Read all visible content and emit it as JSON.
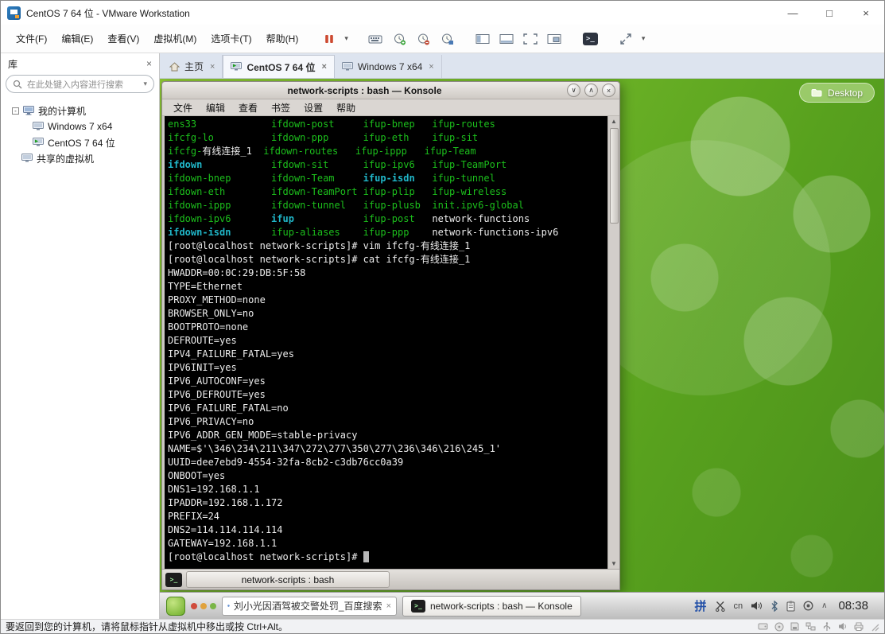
{
  "icons": {
    "minimize": "—",
    "maximize": "□",
    "close": "×",
    "caret_down": "▾",
    "item_close": "×",
    "scroll_up": "▲",
    "scroll_down": "▼",
    "k_min": "∨",
    "k_max": "∧",
    "k_close": "×",
    "tray_caret": "∧",
    "console_prompt": ">_"
  },
  "colors": {
    "terminal_bg": "#000000",
    "terminal_green": "#1CBF1C",
    "terminal_cyan": "#20B6C8",
    "terminal_fg": "#EDEDED",
    "cursor": "#B8B8B8",
    "wallpaper_green": "#6DB327"
  },
  "vmware": {
    "window_title": "CentOS 7 64 位 - VMware Workstation",
    "menus": [
      "文件(F)",
      "编辑(E)",
      "查看(V)",
      "虚拟机(M)",
      "选项卡(T)",
      "帮助(H)"
    ],
    "tabs": [
      {
        "label": "主页"
      },
      {
        "label": "CentOS 7 64 位"
      },
      {
        "label": "Windows 7 x64"
      }
    ],
    "status_message": "要返回到您的计算机，请将鼠标指针从虚拟机中移出或按 Ctrl+Alt。"
  },
  "library": {
    "title": "库",
    "search_placeholder": "在此处键入内容进行搜索",
    "tree": [
      {
        "label": "我的计算机"
      },
      {
        "label": "Windows 7 x64"
      },
      {
        "label": "CentOS 7 64 位"
      },
      {
        "label": "共享的虚拟机"
      }
    ]
  },
  "vm_desktop": {
    "widget_label": "Desktop",
    "taskbar": {
      "search_text": "刘小光因酒驾被交警处罚_百度搜索",
      "konsole_task": "network-scripts : bash — Konsole",
      "input_method": "拼",
      "keyboard_layout": "cn",
      "clock": "08:38"
    }
  },
  "konsole": {
    "title": "network-scripts : bash — Konsole",
    "menus": [
      "文件",
      "编辑",
      "查看",
      "书签",
      "设置",
      "帮助"
    ],
    "tab_label": "network-scripts : bash"
  },
  "terminal": {
    "lines": [
      [
        {
          "t": "ens33             ",
          "c": "g"
        },
        {
          "t": "ifdown-post     ",
          "c": "g"
        },
        {
          "t": "ifup-bnep   ",
          "c": "g"
        },
        {
          "t": "ifup-routes",
          "c": "g"
        }
      ],
      [
        {
          "t": "ifcfg-lo          ",
          "c": "g"
        },
        {
          "t": "ifdown-ppp      ",
          "c": "g"
        },
        {
          "t": "ifup-eth    ",
          "c": "g"
        },
        {
          "t": "ifup-sit",
          "c": "g"
        }
      ],
      [
        {
          "t": "ifcfg-",
          "c": "g"
        },
        {
          "t": "有线连接_1",
          "c": "w"
        },
        {
          "t": "  ",
          "c": "g"
        },
        {
          "t": "ifdown-routes   ",
          "c": "g"
        },
        {
          "t": "ifup-ippp   ",
          "c": "g"
        },
        {
          "t": "ifup-Team",
          "c": "g"
        }
      ],
      [
        {
          "t": "ifdown            ",
          "c": "c"
        },
        {
          "t": "ifdown-sit      ",
          "c": "g"
        },
        {
          "t": "ifup-ipv6   ",
          "c": "g"
        },
        {
          "t": "ifup-TeamPort",
          "c": "g"
        }
      ],
      [
        {
          "t": "ifdown-bnep       ",
          "c": "g"
        },
        {
          "t": "ifdown-Team     ",
          "c": "g"
        },
        {
          "t": "ifup-isdn",
          "c": "c"
        },
        {
          "t": "   ",
          "c": "g"
        },
        {
          "t": "ifup-tunnel",
          "c": "g"
        }
      ],
      [
        {
          "t": "ifdown-eth        ",
          "c": "g"
        },
        {
          "t": "ifdown-TeamPort ",
          "c": "g"
        },
        {
          "t": "ifup-plip   ",
          "c": "g"
        },
        {
          "t": "ifup-wireless",
          "c": "g"
        }
      ],
      [
        {
          "t": "ifdown-ippp       ",
          "c": "g"
        },
        {
          "t": "ifdown-tunnel   ",
          "c": "g"
        },
        {
          "t": "ifup-plusb  ",
          "c": "g"
        },
        {
          "t": "init.ipv6-global",
          "c": "g"
        }
      ],
      [
        {
          "t": "ifdown-ipv6       ",
          "c": "g"
        },
        {
          "t": "ifup",
          "c": "c"
        },
        {
          "t": "            ",
          "c": "g"
        },
        {
          "t": "ifup-post   ",
          "c": "g"
        },
        {
          "t": "network-functions",
          "c": "w"
        }
      ],
      [
        {
          "t": "ifdown-isdn",
          "c": "c"
        },
        {
          "t": "       ",
          "c": "g"
        },
        {
          "t": "ifup-aliases    ",
          "c": "g"
        },
        {
          "t": "ifup-ppp    ",
          "c": "g"
        },
        {
          "t": "network-functions-ipv6",
          "c": "w"
        }
      ],
      [
        {
          "t": "[root@localhost network-scripts]# vim ifcfg-",
          "c": "w"
        },
        {
          "t": "有线连接_1",
          "c": "w"
        }
      ],
      [
        {
          "t": "[root@localhost network-scripts]# cat ifcfg-",
          "c": "w"
        },
        {
          "t": "有线连接_1",
          "c": "w"
        }
      ],
      [
        {
          "t": "HWADDR=00:0C:29:DB:5F:58",
          "c": "w"
        }
      ],
      [
        {
          "t": "TYPE=Ethernet",
          "c": "w"
        }
      ],
      [
        {
          "t": "PROXY_METHOD=none",
          "c": "w"
        }
      ],
      [
        {
          "t": "BROWSER_ONLY=no",
          "c": "w"
        }
      ],
      [
        {
          "t": "BOOTPROTO=none",
          "c": "w"
        }
      ],
      [
        {
          "t": "DEFROUTE=yes",
          "c": "w"
        }
      ],
      [
        {
          "t": "IPV4_FAILURE_FATAL=yes",
          "c": "w"
        }
      ],
      [
        {
          "t": "IPV6INIT=yes",
          "c": "w"
        }
      ],
      [
        {
          "t": "IPV6_AUTOCONF=yes",
          "c": "w"
        }
      ],
      [
        {
          "t": "IPV6_DEFROUTE=yes",
          "c": "w"
        }
      ],
      [
        {
          "t": "IPV6_FAILURE_FATAL=no",
          "c": "w"
        }
      ],
      [
        {
          "t": "IPV6_PRIVACY=no",
          "c": "w"
        }
      ],
      [
        {
          "t": "IPV6_ADDR_GEN_MODE=stable-privacy",
          "c": "w"
        }
      ],
      [
        {
          "t": "NAME=$'\\346\\234\\211\\347\\272\\277\\350\\277\\236\\346\\216\\245_1'",
          "c": "w"
        }
      ],
      [
        {
          "t": "UUID=dee7ebd9-4554-32fa-8cb2-c3db76cc0a39",
          "c": "w"
        }
      ],
      [
        {
          "t": "ONBOOT=yes",
          "c": "w"
        }
      ],
      [
        {
          "t": "DNS1=192.168.1.1",
          "c": "w"
        }
      ],
      [
        {
          "t": "IPADDR=192.168.1.172",
          "c": "w"
        }
      ],
      [
        {
          "t": "PREFIX=24",
          "c": "w"
        }
      ],
      [
        {
          "t": "DNS2=114.114.114.114",
          "c": "w"
        }
      ],
      [
        {
          "t": "GATEWAY=192.168.1.1",
          "c": "w"
        }
      ],
      [
        {
          "t": "[root@localhost network-scripts]# ",
          "c": "w"
        },
        {
          "t": " ",
          "c": "cur"
        }
      ]
    ]
  }
}
